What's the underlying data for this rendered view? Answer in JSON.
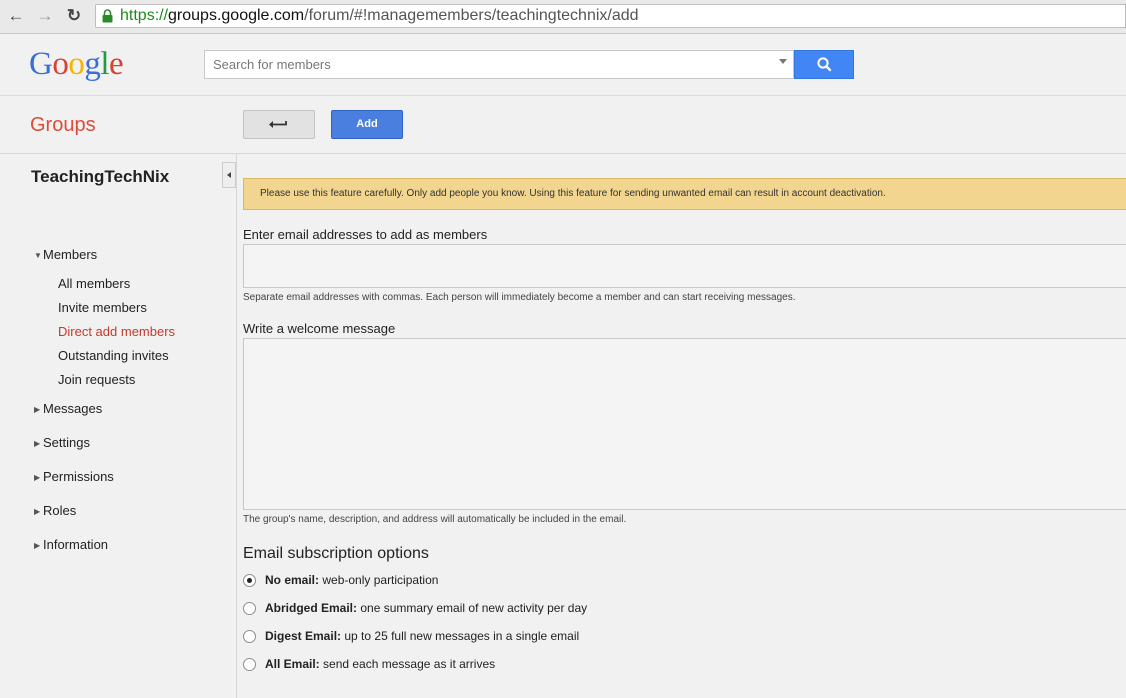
{
  "browser": {
    "url_scheme": "https://",
    "url_host": "groups.google.com",
    "url_path": "/forum/#!managemembers/teachingtechnix/add",
    "back_icon": "←",
    "forward_icon": "→",
    "reload_icon": "↻"
  },
  "header": {
    "logo_letters": [
      {
        "ch": "G",
        "color": "#3b6fd8"
      },
      {
        "ch": "o",
        "color": "#d34336"
      },
      {
        "ch": "o",
        "color": "#f4b400"
      },
      {
        "ch": "g",
        "color": "#3b6fd8"
      },
      {
        "ch": "l",
        "color": "#1e9b45"
      },
      {
        "ch": "e",
        "color": "#d34336"
      }
    ],
    "search_placeholder": "Search for members"
  },
  "groupsbar": {
    "title": "Groups",
    "add_label": "Add"
  },
  "sidebar": {
    "group_name": "TeachingTechNix",
    "members_label": "Members",
    "members_items": [
      "All members",
      "Invite members",
      "Direct add members",
      "Outstanding invites",
      "Join requests"
    ],
    "active_item": "Direct add members",
    "sections": [
      "Messages",
      "Settings",
      "Permissions",
      "Roles",
      "Information"
    ]
  },
  "main": {
    "warning": "Please use this feature carefully. Only add people you know. Using this feature for sending unwanted email can result in account deactivation.",
    "emails_label": "Enter email addresses to add as members",
    "emails_hint": "Separate email addresses with commas. Each person will immediately become a member and can start receiving messages.",
    "welcome_label": "Write a welcome message",
    "welcome_hint": "The group's name, description, and address will automatically be included in the email.",
    "subscription_title": "Email subscription options",
    "options": [
      {
        "name": "No email:",
        "desc": "web-only participation",
        "checked": true
      },
      {
        "name": "Abridged Email:",
        "desc": "one summary email of new activity per day",
        "checked": false
      },
      {
        "name": "Digest Email:",
        "desc": "up to 25 full new messages in a single email",
        "checked": false
      },
      {
        "name": "All Email:",
        "desc": "send each message as it arrives",
        "checked": false
      }
    ]
  },
  "colors": {
    "accent_blue": "#4285f4",
    "groups_red": "#dd4b39",
    "warning_bg": "#f2d58f"
  }
}
